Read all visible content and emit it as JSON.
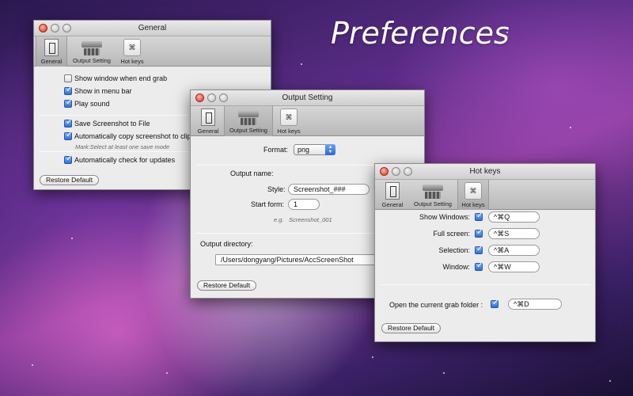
{
  "headline": "Preferences",
  "toolbar": {
    "general": "General",
    "output": "Output Setting",
    "hotkeys": "Hot keys",
    "hotkey_glyph": "⌘"
  },
  "general_window": {
    "title": "General",
    "options": [
      {
        "label": "Show window when end grab",
        "checked": false
      },
      {
        "label": "Show in menu bar",
        "checked": true
      },
      {
        "label": "Play sound",
        "checked": true
      },
      {
        "label": "Save Screenshot to File",
        "checked": true
      },
      {
        "label": "Automatically copy screenshot to clipb",
        "checked": true
      },
      {
        "label": "Automatically check for updates",
        "checked": true
      }
    ],
    "mark": "Mark:Select at least one save mode",
    "restore": "Restore Default"
  },
  "output_window": {
    "title": "Output Setting",
    "format_label": "Format:",
    "format_value": "png",
    "output_name_label": "Output name:",
    "style_label": "Style:",
    "style_value": "Screenshot_###",
    "start_label": "Start form:",
    "start_value": "1",
    "example_prefix": "e.g.",
    "example_value": "Screenshot_001",
    "directory_label": "Output directory:",
    "directory_value": "/Users/dongyang/Pictures/AccScreenShot",
    "restore": "Restore Default"
  },
  "hotkeys_window": {
    "title": "Hot keys",
    "rows": [
      {
        "label": "Show Windows:",
        "key": "^⌘Q"
      },
      {
        "label": "Full screen:",
        "key": "^⌘S"
      },
      {
        "label": "Selection:",
        "key": "^⌘A"
      },
      {
        "label": "Window:",
        "key": "^⌘W"
      }
    ],
    "folder_label": "Open the current grab folder :",
    "folder_key": "^⌘D",
    "restore": "Restore Default"
  }
}
